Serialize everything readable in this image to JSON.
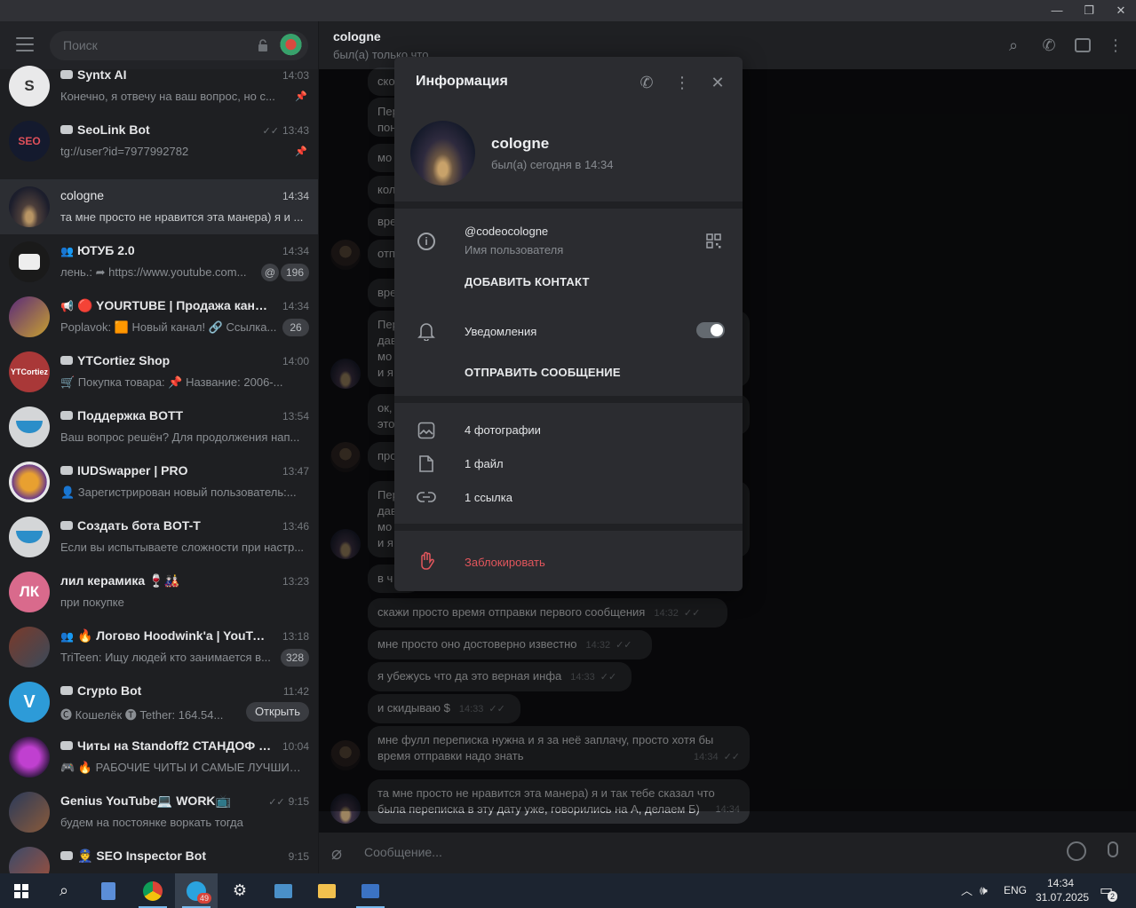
{
  "sidebar": {
    "search_placeholder": "Поиск",
    "chats": [
      {
        "name": "Syntx AI",
        "time": "14:03",
        "preview": "Конечно, я отвечу на ваш вопрос, но с...",
        "pinned": "📌"
      },
      {
        "name": "SeoLink Bot",
        "time": "13:43",
        "preview": "tg://user?id=7977992782",
        "pinned": "📌"
      },
      {
        "name": "cologne",
        "time": "14:34",
        "preview": "та мне просто не нравится эта манера) я и ..."
      },
      {
        "name": "ЮТУБ 2.0",
        "time": "14:34",
        "preview": "лень.: ➦ https://www.youtube.com...",
        "badge": "196"
      },
      {
        "name": "🔴 YOURTUBE | Продажа канал...",
        "time": "14:34",
        "preview": "Poplavok: 🟧 Новый канал! 🔗 Ссылка...",
        "badge": "26"
      },
      {
        "name": "YTCortiez Shop",
        "time": "14:00",
        "preview": "🛒 Покупка товара: 📌 Название: 2006-..."
      },
      {
        "name": "Поддержка BOTT",
        "time": "13:54",
        "preview": "Ваш вопрос решён? Для продолжения нап..."
      },
      {
        "name": "IUDSwapper | PRO",
        "time": "13:47",
        "preview": "👤 Зарегистрирован новый пользователь:..."
      },
      {
        "name": "Создать бота BOT-T",
        "time": "13:46",
        "preview": "Если вы испытываете сложности при настр..."
      },
      {
        "name": "лил керамика 🍷🎎",
        "time": "13:23",
        "preview": "при покупке",
        "avatar_text": "ЛК"
      },
      {
        "name": "🔥 Логово Hoodwink'a | YouTub...",
        "time": "13:18",
        "preview": "TriTeen: Ищу людей кто занимается в...",
        "badge": "328"
      },
      {
        "name": "Crypto Bot",
        "time": "11:42",
        "preview": "🅒 Кошелёк 🅣 Tether: 164.54...",
        "button": "Открыть"
      },
      {
        "name": "Читы на Standoff2 СТАНДОФ / СТ...",
        "time": "10:04",
        "preview": "🎮 🔥 РАБОЧИЕ ЧИТЫ И САМЫЕ ЛУЧШИЕ ..."
      },
      {
        "name": "Genius YouTube💻 WORK📺",
        "time": "9:15",
        "preview": "будем на постоянке воркать тогда"
      },
      {
        "name": "👮 SEO Inspector Bot",
        "time": "9:15",
        "preview": ""
      }
    ]
  },
  "chat_header": {
    "title": "cologne",
    "status": "был(а) только что"
  },
  "messages": {
    "m1": {
      "text": "скажи просто время отправки первого сообщения",
      "time": "14:32"
    },
    "m2": {
      "text": "мне просто оно достоверно известно",
      "time": "14:32"
    },
    "m3": {
      "text": "я убежусь что да это верная инфа",
      "time": "14:33"
    },
    "m4": {
      "text": "и скидываю $",
      "time": "14:33"
    },
    "m5a": {
      "text": "мне фулл переписка нужна и я за неё заплачу, просто хотя бы"
    },
    "m5b": {
      "text": "время отправки надо знать",
      "time": "14:34"
    },
    "m6a": {
      "text": "та мне просто не нравится эта манера) я и так тебе сказал что"
    },
    "m6b": {
      "text": "была переписка в эту дату уже, говорились на А, делаем Б)",
      "time": "14:34"
    },
    "partials": [
      "ско",
      "Пер",
      "пон",
      "мо",
      "кол",
      "вре",
      "отп",
      "вре",
      "Пер",
      "дав",
      "мо",
      "и я",
      "ок,",
      "это",
      "про",
      "Пер",
      "дав",
      "мо",
      "и я",
      "в ч"
    ]
  },
  "composer": {
    "placeholder": "Сообщение..."
  },
  "info_modal": {
    "title": "Информация",
    "name": "cologne",
    "status": "был(а) сегодня в 14:34",
    "username": "@codeocologne",
    "username_label": "Имя пользователя",
    "add_contact": "ДОБАВИТЬ КОНТАКТ",
    "notifications": "Уведомления",
    "notifications_on": true,
    "send_message": "ОТПРАВИТЬ СООБЩЕНИЕ",
    "photos": "4 фотографии",
    "files": "1 файл",
    "links": "1 ссылка",
    "block": "Заблокировать"
  },
  "taskbar": {
    "lang": "ENG",
    "time": "14:34",
    "date": "31.07.2025",
    "telegram_badge": "49",
    "notif_count": "2"
  },
  "colors": {
    "accent_red": "#e2565c",
    "panel": "#2b2c30",
    "sidebar": "#1e1f22"
  }
}
